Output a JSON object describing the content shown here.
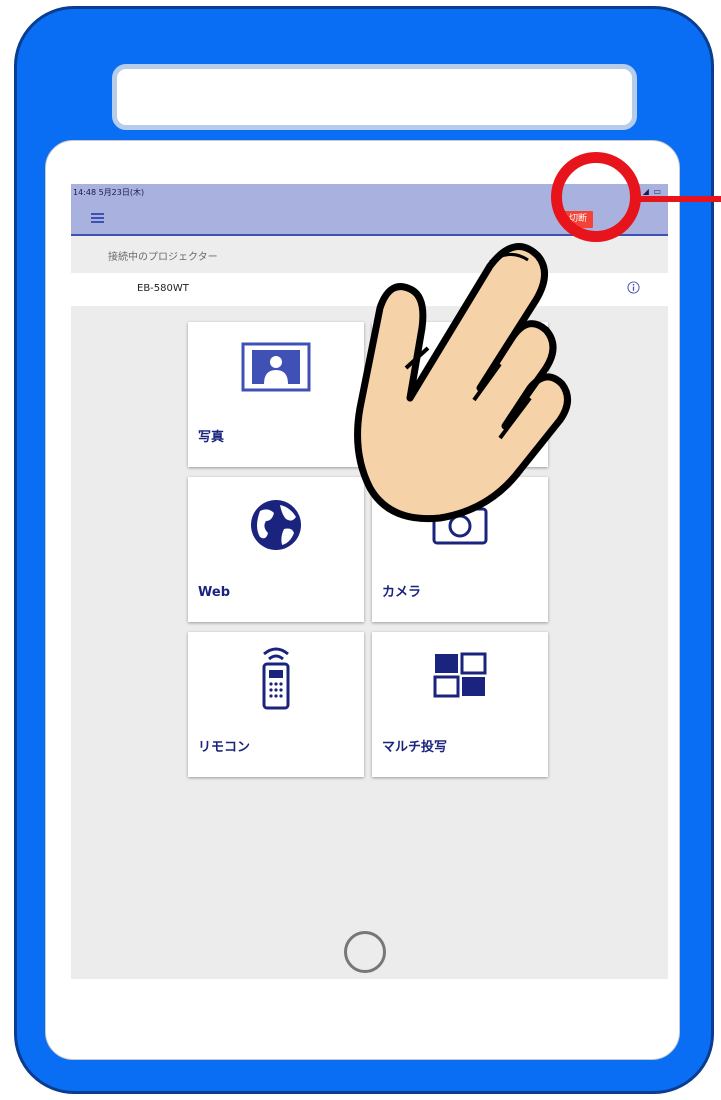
{
  "statusbar": {
    "time": "14:48  5月23日(木)",
    "indicators": "▿ ◢ ▭"
  },
  "navbar": {
    "disconnect_label": "切断"
  },
  "projector_section": {
    "header": "接続中のプロジェクター",
    "projector_name": "EB-580WT"
  },
  "tiles": [
    {
      "label": "写真",
      "icon": "photo-icon"
    },
    {
      "label": "",
      "icon": "document-icon"
    },
    {
      "label": "Web",
      "icon": "globe-icon"
    },
    {
      "label": "カメラ",
      "icon": "camera-icon"
    },
    {
      "label": "リモコン",
      "icon": "remote-control-icon"
    },
    {
      "label": "マルチ投写",
      "icon": "multi-projection-icon"
    }
  ],
  "colors": {
    "tablet_frame": "#0a6ef5",
    "navbar": "#a9b1de",
    "accent": "#3f51b5",
    "tile_text": "#1a237e",
    "disconnect_button": "#f44336",
    "highlight": "#e8141b",
    "hand": "#f6d2a8"
  }
}
